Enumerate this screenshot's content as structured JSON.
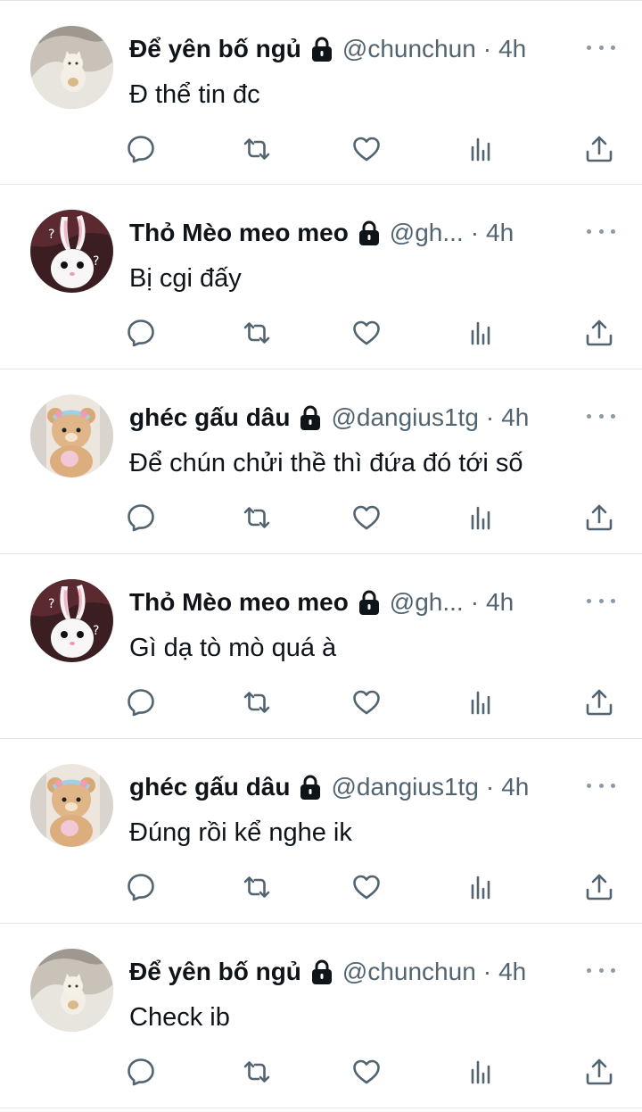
{
  "feed": {
    "tweets": [
      {
        "name": "Để yên bố ngủ",
        "handle": "@chunchun",
        "separator": "·",
        "time": "4h",
        "text": "Đ thể tin đc",
        "avatar": "cat-plush-avatar"
      },
      {
        "name": "Thỏ Mèo meo meo",
        "handle": "@gh...",
        "separator": "·",
        "time": "4h",
        "text": "Bị cgi đấy",
        "avatar": "bunny-avatar"
      },
      {
        "name": "ghéc gấu dâu",
        "handle": "@dangius1tg",
        "separator": "·",
        "time": "4h",
        "text": "Để chún chửi thề thì đứa đó tới số",
        "avatar": "bear-plush-avatar"
      },
      {
        "name": "Thỏ Mèo meo meo",
        "handle": "@gh...",
        "separator": "·",
        "time": "4h",
        "text": "Gì dạ tò mò quá à",
        "avatar": "bunny-avatar"
      },
      {
        "name": "ghéc gấu dâu",
        "handle": "@dangius1tg",
        "separator": "·",
        "time": "4h",
        "text": "Đúng rồi kể nghe ik",
        "avatar": "bear-plush-avatar"
      },
      {
        "name": "Để yên bố ngủ",
        "handle": "@chunchun",
        "separator": "·",
        "time": "4h",
        "text": "Check ib",
        "avatar": "cat-plush-avatar"
      }
    ]
  },
  "icons": {
    "lock": "lock-icon",
    "more": "more-icon",
    "reply": "reply-icon",
    "retweet": "retweet-icon",
    "like": "heart-icon",
    "views": "views-icon",
    "share": "share-icon"
  },
  "colors": {
    "text": "#0f1419",
    "secondary": "#536471",
    "icon": "#536471",
    "divider": "#e1e6ea"
  }
}
